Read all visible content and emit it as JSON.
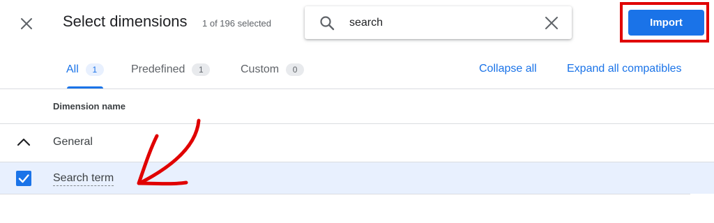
{
  "header": {
    "title": "Select dimensions",
    "selected_count": "1 of 196 selected",
    "close_icon": "close-icon"
  },
  "search": {
    "value": "search",
    "placeholder": "",
    "search_icon": "search-icon",
    "clear_icon": "close-icon"
  },
  "actions": {
    "import_label": "Import",
    "import_color": "#1a73e8",
    "highlight_color": "#e00000"
  },
  "tabs": [
    {
      "label": "All",
      "count": "1",
      "active": true
    },
    {
      "label": "Predefined",
      "count": "1",
      "active": false
    },
    {
      "label": "Custom",
      "count": "0",
      "active": false
    }
  ],
  "links": {
    "collapse_all": "Collapse all",
    "expand_all": "Expand all compatibles"
  },
  "table": {
    "column_header": "Dimension name",
    "groups": [
      {
        "label": "General",
        "expanded": true,
        "chevron_icon": "chevron-up-icon",
        "items": [
          {
            "label": "Search term",
            "checked": true,
            "checkbox_icon": "checkbox-checked-icon"
          }
        ]
      }
    ]
  },
  "annotation": {
    "type": "hand-drawn-arrow-icon",
    "color": "#e00000"
  }
}
